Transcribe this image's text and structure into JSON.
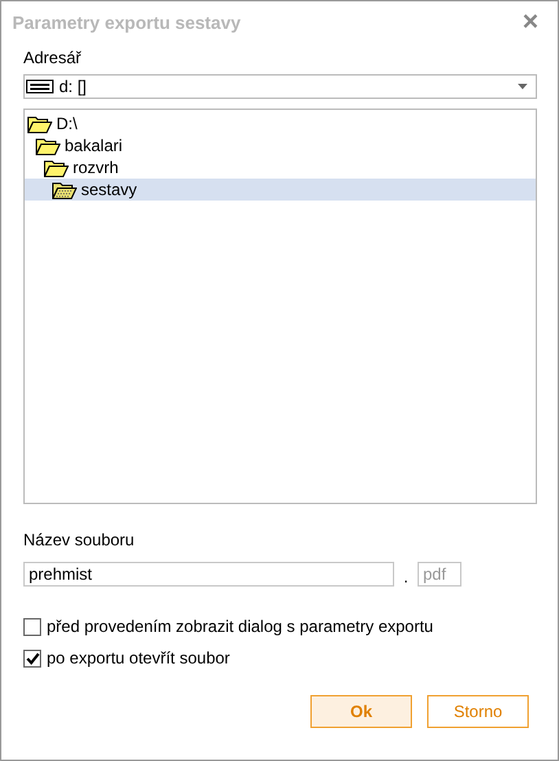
{
  "window": {
    "title": "Parametry exportu sestavy",
    "close": "×"
  },
  "directory": {
    "label": "Adresář",
    "drive": "d: []",
    "tree": [
      {
        "label": "D:\\",
        "selected": false,
        "children": [
          {
            "label": "bakalari",
            "selected": false,
            "children": [
              {
                "label": "rozvrh",
                "selected": false,
                "children": [
                  {
                    "label": "sestavy",
                    "selected": true
                  }
                ]
              }
            ]
          }
        ]
      }
    ]
  },
  "file": {
    "label": "Název souboru",
    "value": "prehmist",
    "separator": ".",
    "extension": "pdf"
  },
  "options": [
    {
      "label": "před provedením zobrazit dialog s parametry exportu",
      "checked": false
    },
    {
      "label": "po exportu otevřít soubor",
      "checked": true
    }
  ],
  "buttons": [
    {
      "label": "Ok",
      "kind": "primary"
    },
    {
      "label": "Storno",
      "kind": "secondary"
    }
  ]
}
